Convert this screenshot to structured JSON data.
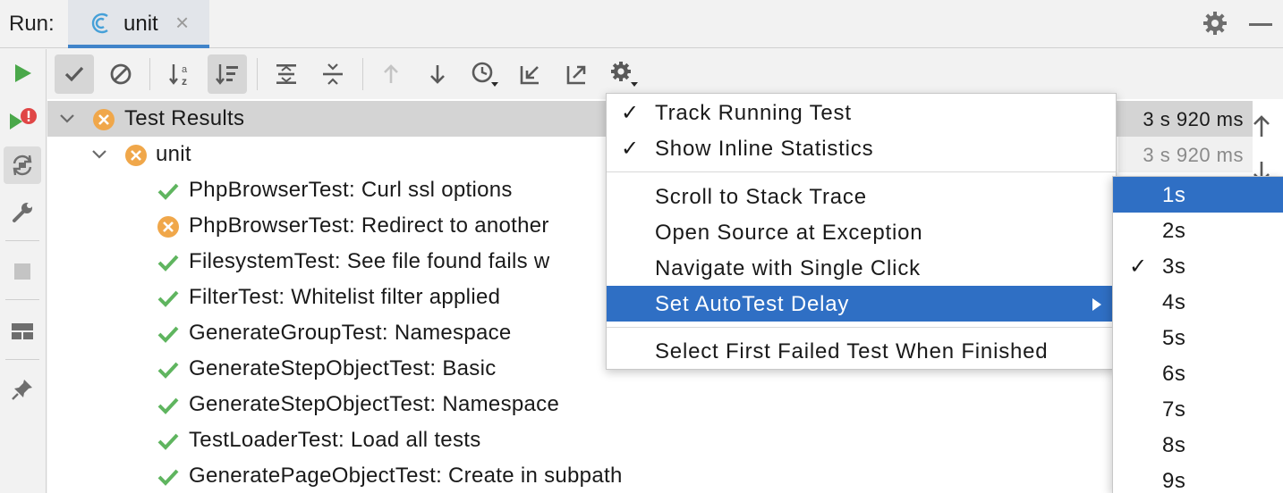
{
  "header": {
    "run_label": "Run:",
    "tab_label": "unit",
    "tab_close": "×"
  },
  "tree": {
    "root": {
      "label": "Test Results",
      "duration": "3 s 920 ms",
      "status": "failed"
    },
    "suite": {
      "label": "unit",
      "duration": "3 s 920 ms",
      "status": "failed"
    },
    "tests": [
      {
        "label": "PhpBrowserTest: Curl ssl options",
        "status": "passed"
      },
      {
        "label": "PhpBrowserTest: Redirect to another",
        "status": "failed"
      },
      {
        "label": "FilesystemTest: See file found fails w",
        "status": "passed"
      },
      {
        "label": "FilterTest: Whitelist filter applied",
        "status": "passed"
      },
      {
        "label": "GenerateGroupTest: Namespace",
        "status": "passed"
      },
      {
        "label": "GenerateStepObjectTest: Basic",
        "status": "passed"
      },
      {
        "label": "GenerateStepObjectTest: Namespace",
        "status": "passed"
      },
      {
        "label": "TestLoaderTest: Load all tests",
        "status": "passed"
      },
      {
        "label": "GeneratePageObjectTest: Create in subpath",
        "status": "passed"
      }
    ]
  },
  "menu": {
    "items": [
      {
        "label": "Track Running Test",
        "checked": "✓"
      },
      {
        "label": "Show Inline Statistics",
        "checked": "✓"
      },
      {
        "label": "Scroll to Stack Trace",
        "checked": ""
      },
      {
        "label": "Open Source at Exception",
        "checked": ""
      },
      {
        "label": "Navigate with Single Click",
        "checked": ""
      },
      {
        "label": "Set AutoTest Delay",
        "checked": ""
      },
      {
        "label": "Select First Failed Test When Finished",
        "checked": ""
      }
    ]
  },
  "submenu": {
    "items": [
      {
        "label": "1s",
        "checked": ""
      },
      {
        "label": "2s",
        "checked": ""
      },
      {
        "label": "3s",
        "checked": "✓"
      },
      {
        "label": "4s",
        "checked": ""
      },
      {
        "label": "5s",
        "checked": ""
      },
      {
        "label": "6s",
        "checked": ""
      },
      {
        "label": "7s",
        "checked": ""
      },
      {
        "label": "8s",
        "checked": ""
      },
      {
        "label": "9s",
        "checked": ""
      }
    ]
  },
  "colors": {
    "accent": "#2f6fc4",
    "passed": "#5fb55f",
    "failed": "#f0a74a",
    "run_green": "#4aa84a",
    "error_red": "#e04646"
  }
}
